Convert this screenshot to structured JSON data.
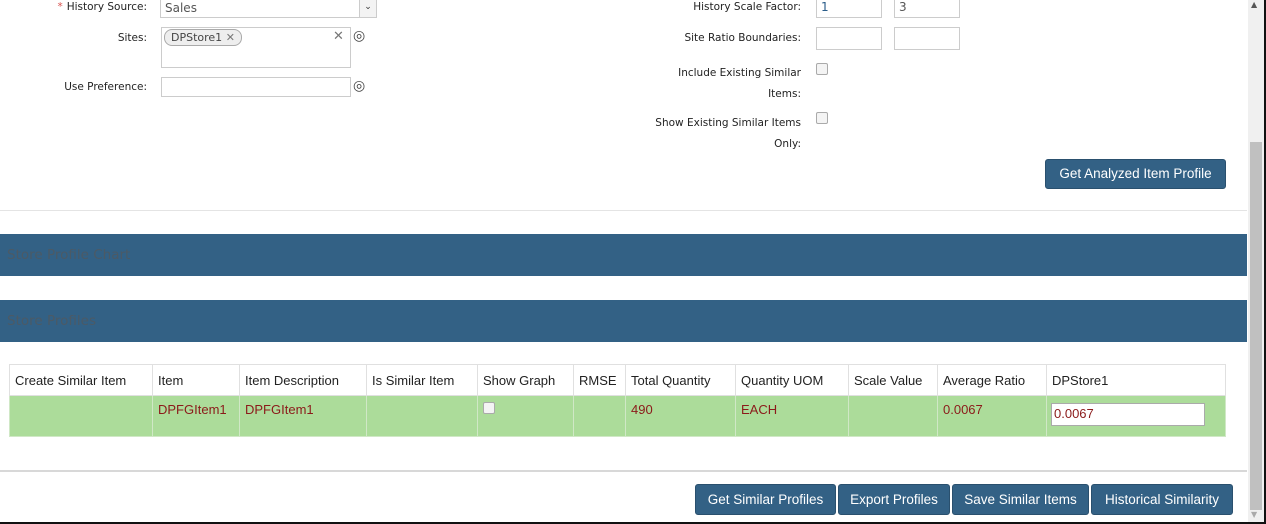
{
  "form": {
    "history_source": {
      "label": "History Source:",
      "value": "Sales",
      "required": true
    },
    "sites": {
      "label": "Sites:",
      "chips": [
        "DPStore1"
      ]
    },
    "use_preference": {
      "label": "Use Preference:",
      "value": ""
    },
    "history_scale_factor": {
      "label": "History Scale Factor:",
      "min": "1",
      "max": "3"
    },
    "site_ratio_boundaries": {
      "label": "Site Ratio Boundaries:",
      "min": "",
      "max": ""
    },
    "include_existing": {
      "label1": "Include Existing Similar",
      "label2": "Items:",
      "checked": false
    },
    "show_existing_only": {
      "label1": "Show Existing Similar Items",
      "label2": "Only:",
      "checked": false
    },
    "get_profile_button": "Get Analyzed Item Profile"
  },
  "sections": {
    "chart": "Store Profile Chart",
    "profiles": "Store Profiles"
  },
  "table": {
    "headers": [
      "Create Similar Item",
      "Item",
      "Item Description",
      "Is Similar Item",
      "Show Graph",
      "RMSE",
      "Total Quantity",
      "Quantity UOM",
      "Scale Value",
      "Average Ratio",
      "DPStore1"
    ],
    "rows": [
      {
        "create": "",
        "item": "DPFGItem1",
        "desc": "DPFGItem1",
        "is_similar": "",
        "show_graph": false,
        "rmse": "",
        "total": "490",
        "uom": "EACH",
        "scale": "",
        "avg": "0.0067",
        "store": "0.0067"
      }
    ]
  },
  "footer": [
    "Get Similar Profiles",
    "Export Profiles",
    "Save Similar Items",
    "Historical Similarity"
  ],
  "colors": {
    "accent": "#336185",
    "row": "#acdc9a",
    "value": "#8b1a1a"
  }
}
